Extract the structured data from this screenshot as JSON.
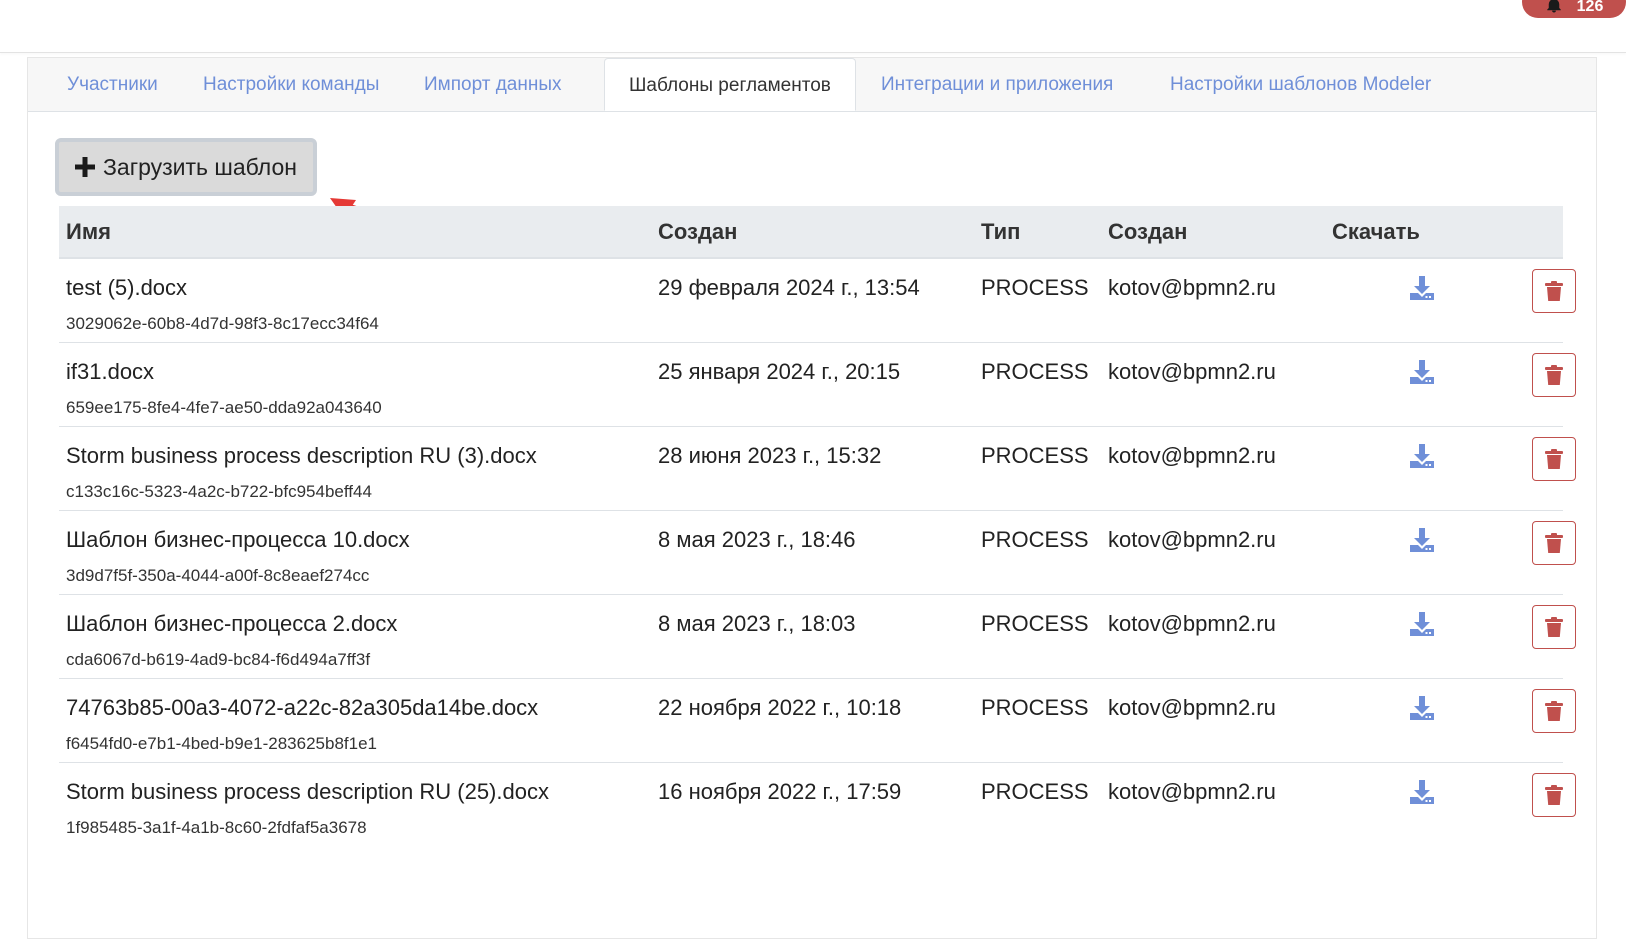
{
  "header": {
    "notifications_count": "126"
  },
  "tabs": [
    {
      "label": "Участники",
      "active": false
    },
    {
      "label": "Настройки команды",
      "active": false
    },
    {
      "label": "Импорт данных",
      "active": false
    },
    {
      "label": "Шаблоны регламентов",
      "active": true
    },
    {
      "label": "Интеграции и приложения",
      "active": false
    },
    {
      "label": "Настройки шаблонов Modeler",
      "active": false
    }
  ],
  "toolbar": {
    "upload_label": "Загрузить шаблон"
  },
  "table": {
    "columns": [
      "Имя",
      "Создан",
      "Тип",
      "Создан",
      "Скачать"
    ],
    "rows": [
      {
        "name": "test (5).docx",
        "id": "3029062e-60b8-4d7d-98f3-8c17ecc34f64",
        "created": "29 февраля 2024 г., 13:54",
        "type": "PROCESS",
        "author": "kotov@bpmn2.ru"
      },
      {
        "name": "if31.docx",
        "id": "659ee175-8fe4-4fe7-ae50-dda92a043640",
        "created": "25 января 2024 г., 20:15",
        "type": "PROCESS",
        "author": "kotov@bpmn2.ru"
      },
      {
        "name": "Storm business process description RU (3).docx",
        "id": "c133c16c-5323-4a2c-b722-bfc954beff44",
        "created": "28 июня 2023 г., 15:32",
        "type": "PROCESS",
        "author": "kotov@bpmn2.ru"
      },
      {
        "name": "Шаблон бизнес-процесса 10.docx",
        "id": "3d9d7f5f-350a-4044-a00f-8c8eaef274cc",
        "created": "8 мая 2023 г., 18:46",
        "type": "PROCESS",
        "author": "kotov@bpmn2.ru"
      },
      {
        "name": "Шаблон бизнес-процесса 2.docx",
        "id": "cda6067d-b619-4ad9-bc84-f6d494a7ff3f",
        "created": "8 мая 2023 г., 18:03",
        "type": "PROCESS",
        "author": "kotov@bpmn2.ru"
      },
      {
        "name": "74763b85-00a3-4072-a22c-82a305da14be.docx",
        "id": "f6454fd0-e7b1-4bed-b9e1-283625b8f1e1",
        "created": "22 ноября 2022 г., 10:18",
        "type": "PROCESS",
        "author": "kotov@bpmn2.ru"
      },
      {
        "name": "Storm business process description RU (25).docx",
        "id": "1f985485-3a1f-4a1b-8c60-2fdfaf5a3678",
        "created": "16 ноября 2022 г., 17:59",
        "type": "PROCESS",
        "author": "kotov@bpmn2.ru"
      }
    ]
  },
  "colors": {
    "link": "#6f8fd8",
    "danger": "#c0504d",
    "download_icon": "#6f8fd8",
    "annotation_arrow": "#e53935"
  },
  "icons": {
    "upload": "plus-icon",
    "download": "download-icon",
    "delete": "trash-icon",
    "notifications": "bell-icon"
  }
}
